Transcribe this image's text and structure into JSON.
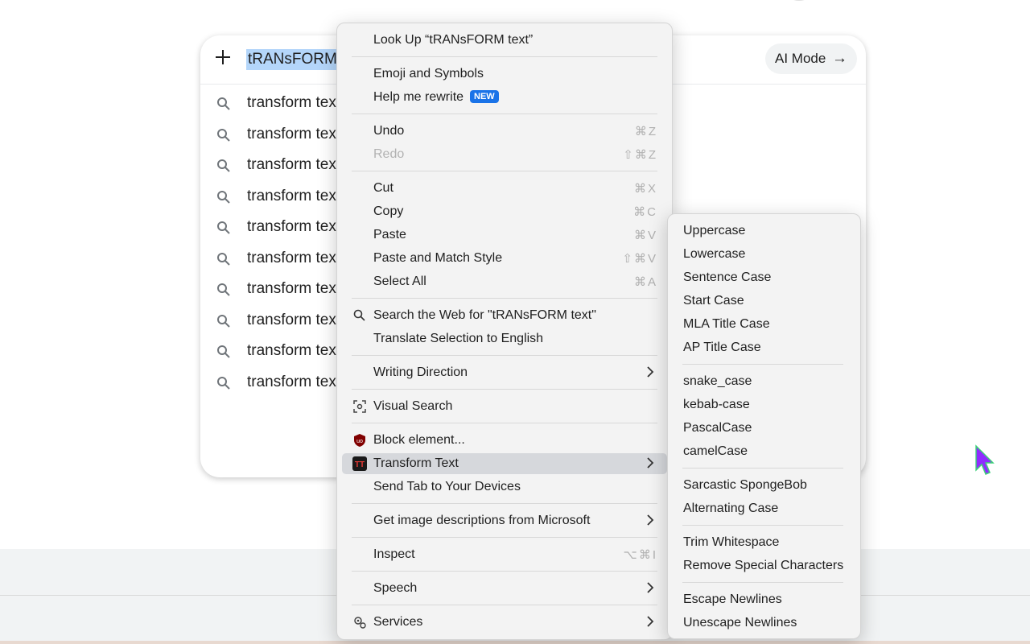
{
  "search": {
    "query": "tRANsFORM",
    "ai_mode_label": "AI Mode",
    "suggestions": [
      "transform tex",
      "transform tex",
      "transform tex",
      "transform tex",
      "transform tex",
      "transform tex",
      "transform tex",
      "transform tex",
      "transform tex",
      "transform tex"
    ]
  },
  "context_menu": {
    "look_up": "Look Up “tRANsFORM text”",
    "emoji": "Emoji and Symbols",
    "help_rewrite": "Help me rewrite",
    "new_badge": "NEW",
    "undo": "Undo",
    "undo_sc": "⌘Z",
    "redo": "Redo",
    "redo_sc": "⇧⌘Z",
    "cut": "Cut",
    "cut_sc": "⌘X",
    "copy": "Copy",
    "copy_sc": "⌘C",
    "paste": "Paste",
    "paste_sc": "⌘V",
    "paste_match": "Paste and Match Style",
    "paste_match_sc": "⇧⌘V",
    "select_all": "Select All",
    "select_all_sc": "⌘A",
    "search_web": "Search the Web for \"tRANsFORM text\"",
    "translate": "Translate Selection to English",
    "writing_direction": "Writing Direction",
    "visual_search": "Visual Search",
    "block_element": "Block element...",
    "transform_text": "Transform Text",
    "send_tab": "Send Tab to Your Devices",
    "image_desc": "Get image descriptions from Microsoft",
    "inspect": "Inspect",
    "inspect_sc": "⌥⌘I",
    "speech": "Speech",
    "services": "Services"
  },
  "submenu": {
    "uppercase": "Uppercase",
    "lowercase": "Lowercase",
    "sentence": "Sentence Case",
    "start": "Start Case",
    "mla": "MLA Title Case",
    "ap": "AP Title Case",
    "snake": "snake_case",
    "kebab": "kebab-case",
    "pascal": "PascalCase",
    "camel": "camelCase",
    "sponge": "Sarcastic SpongeBob",
    "alternating": "Alternating Case",
    "trim": "Trim Whitespace",
    "remove_special": "Remove Special Characters",
    "escape": "Escape Newlines",
    "unescape": "Unescape Newlines"
  },
  "colors": {
    "selection": "#b4d6fa",
    "badge": "#1a73e8",
    "highlight": "#d6d8dc",
    "cursor": "#8f2bff"
  }
}
